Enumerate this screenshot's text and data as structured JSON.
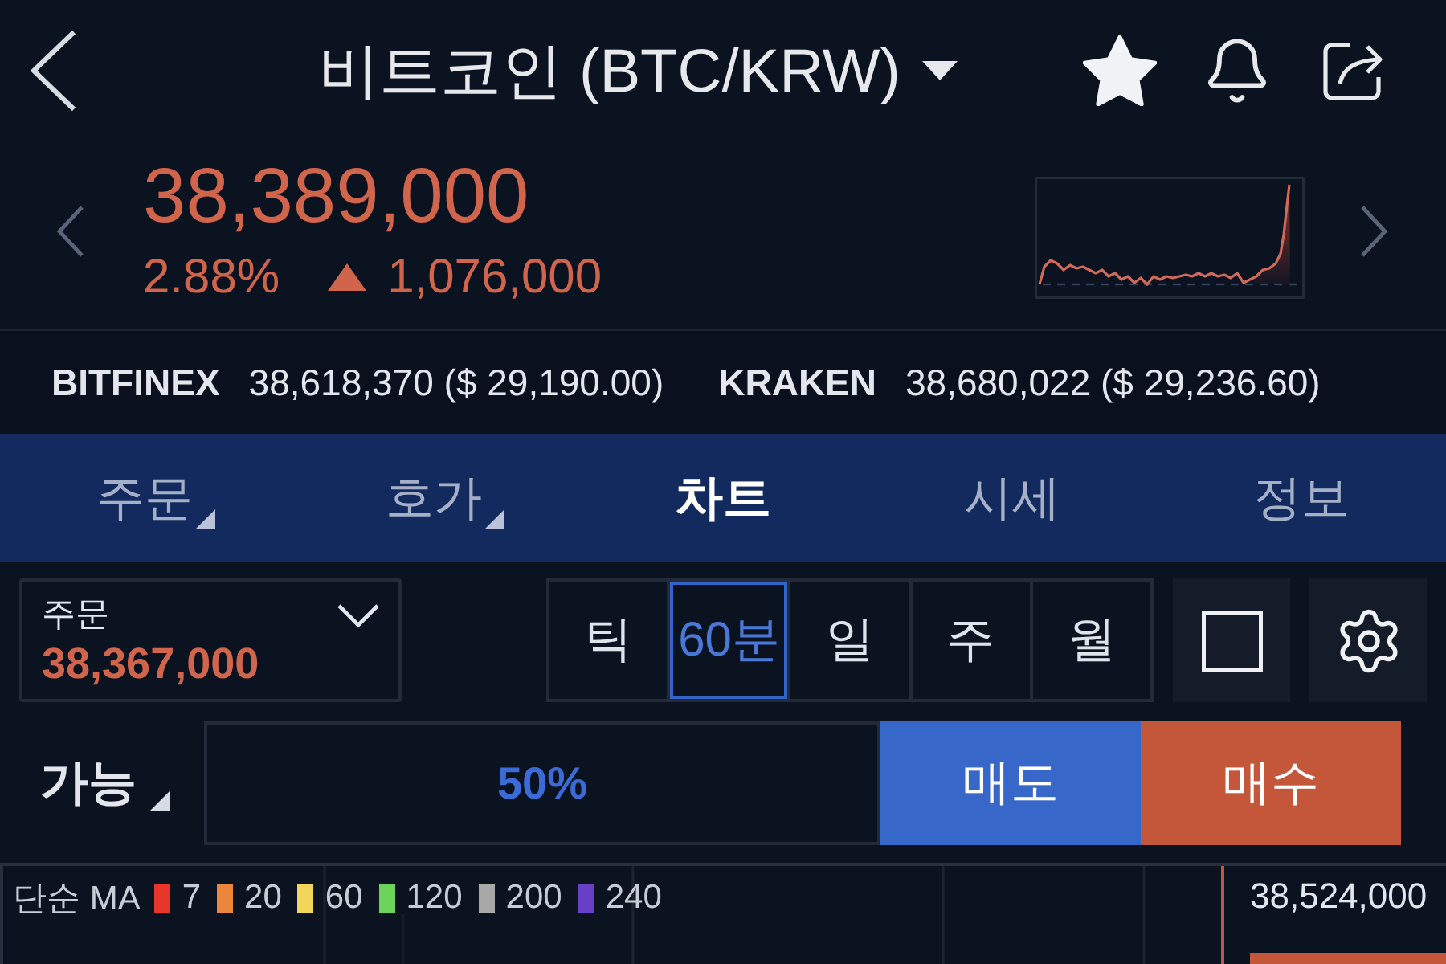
{
  "header": {
    "title": "비트코인 (BTC/KRW)",
    "favorite": true
  },
  "ticker": {
    "price": "38,389,000",
    "change_rate": "2.88%",
    "rising": true,
    "change": "1,076,000"
  },
  "exchanges": [
    {
      "name": "BITFINEX",
      "price": "38,618,370 ($ 29,190.00)"
    },
    {
      "name": "KRAKEN",
      "price": "38,680,022 ($ 29,236.60)"
    }
  ],
  "tabs": [
    {
      "label": "주문",
      "selected": false,
      "dropdown": true
    },
    {
      "label": "호가",
      "selected": false,
      "dropdown": true
    },
    {
      "label": "차트",
      "selected": true,
      "dropdown": false
    },
    {
      "label": "시세",
      "selected": false,
      "dropdown": false
    },
    {
      "label": "정보",
      "selected": false,
      "dropdown": false
    }
  ],
  "order_select": {
    "label": "주문",
    "value": "38,367,000"
  },
  "intervals": [
    {
      "label": "틱",
      "selected": false
    },
    {
      "label": "60분",
      "selected": true
    },
    {
      "label": "일",
      "selected": false
    },
    {
      "label": "주",
      "selected": false
    },
    {
      "label": "월",
      "selected": false
    }
  ],
  "quantity": {
    "label": "가능",
    "value": "50%"
  },
  "trade_buttons": [
    {
      "label": "매도",
      "kind": "sell"
    },
    {
      "label": "매수",
      "kind": "buy"
    }
  ],
  "chart": {
    "ma_label": "단순 MA",
    "ma_lines": [
      {
        "period": "7",
        "color": "#e8372a"
      },
      {
        "period": "20",
        "color": "#e9863c"
      },
      {
        "period": "60",
        "color": "#f2d65a"
      },
      {
        "period": "120",
        "color": "#6cd35a"
      },
      {
        "period": "200",
        "color": "#a8a8a8"
      },
      {
        "period": "240",
        "color": "#6a3fc8"
      }
    ],
    "price_label": "38,524,000"
  }
}
